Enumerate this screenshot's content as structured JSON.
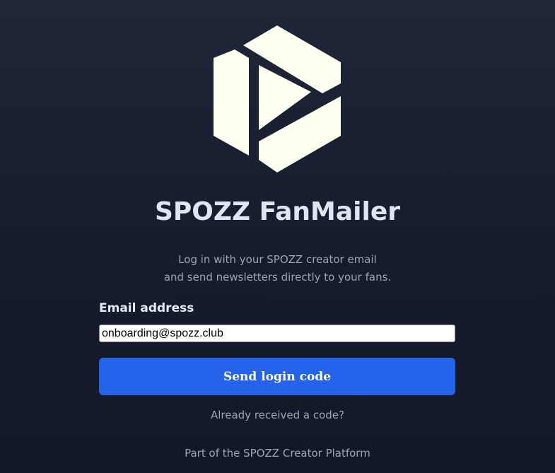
{
  "app": {
    "title": "SPOZZ FanMailer",
    "tagline_line1": "Log in with your SPOZZ creator email",
    "tagline_line2": "and send newsletters directly to your fans.",
    "logo_icon": "spozz-hexagon-play-logo-icon"
  },
  "form": {
    "email_label": "Email address",
    "email_value": "onboarding@spozz.club",
    "submit_label": "Send login code"
  },
  "links": {
    "already_received": "Already received a code?"
  },
  "footer": {
    "text": "Part of the SPOZZ Creator Platform"
  },
  "colors": {
    "background_top": "#1e2638",
    "background_bottom": "#121827",
    "accent_button": "#2563eb",
    "logo_fill": "#fdfff0",
    "title_text": "#dfe6f1",
    "muted_text": "#9aa5b6"
  }
}
